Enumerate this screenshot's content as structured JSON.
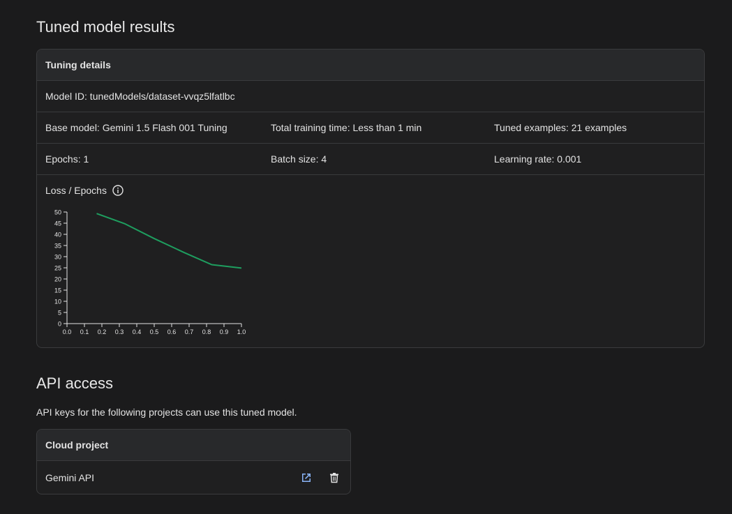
{
  "page_title": "Tuned model results",
  "tuning_details": {
    "header": "Tuning details",
    "model_id": "Model ID: tunedModels/dataset-vvqz5lfatlbc",
    "base_model": "Base model: Gemini 1.5 Flash 001 Tuning",
    "total_training_time": "Total training time: Less than 1 min",
    "tuned_examples": "Tuned examples: 21 examples",
    "epochs": "Epochs: 1",
    "batch_size": "Batch size: 4",
    "learning_rate": "Learning rate: 0.001",
    "chart_label": "Loss / Epochs"
  },
  "chart_data": {
    "type": "line",
    "title": "Loss / Epochs",
    "xlabel": "",
    "ylabel": "",
    "xlim": [
      0.0,
      1.0
    ],
    "ylim": [
      0,
      50
    ],
    "x_ticks": [
      "0.0",
      "0.1",
      "0.2",
      "0.3",
      "0.4",
      "0.5",
      "0.6",
      "0.7",
      "0.8",
      "0.9",
      "1.0"
    ],
    "y_ticks": [
      "0",
      "5",
      "10",
      "15",
      "20",
      "25",
      "30",
      "35",
      "40",
      "45",
      "50"
    ],
    "series": [
      {
        "color": "#1e9e5f",
        "x": [
          0.17,
          0.33,
          0.5,
          0.67,
          0.83,
          1.0
        ],
        "y": [
          49.3,
          44.8,
          38.1,
          31.9,
          26.4,
          24.9
        ]
      }
    ],
    "grid": false
  },
  "api_access": {
    "title": "API access",
    "description": "API keys for the following projects can use this tuned model.",
    "table_header": "Cloud project",
    "projects": [
      {
        "name": "Gemini API"
      }
    ]
  },
  "icons": {
    "info": "info-icon",
    "open": "open-in-new-icon",
    "delete": "trash-icon"
  },
  "colors": {
    "accent_link": "#8ab4f8",
    "line": "#1e9e5f"
  }
}
